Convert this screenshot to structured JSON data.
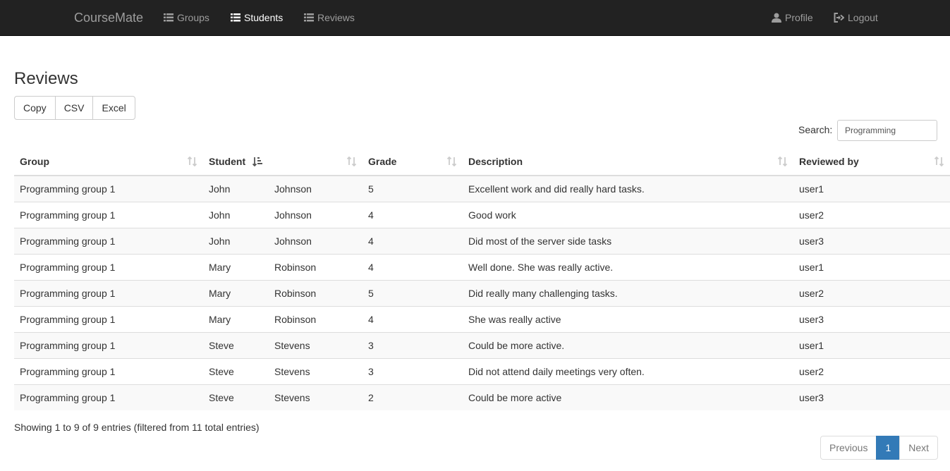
{
  "navbar": {
    "brand": "CourseMate",
    "links": [
      {
        "label": "Groups",
        "icon": "list-icon"
      },
      {
        "label": "Students",
        "icon": "list-icon"
      },
      {
        "label": "Reviews",
        "icon": "list-icon"
      }
    ],
    "profile": {
      "label": "Profile",
      "icon": "user-icon"
    },
    "logout": {
      "label": "Logout",
      "icon": "logout-icon"
    },
    "active_link": "Students"
  },
  "page": {
    "title": "Reviews"
  },
  "export": {
    "copy": "Copy",
    "csv": "CSV",
    "excel": "Excel"
  },
  "search": {
    "label": "Search:",
    "value": "Programming"
  },
  "table": {
    "headers": {
      "group": "Group",
      "student": "Student",
      "grade": "Grade",
      "description": "Description",
      "reviewed_by": "Reviewed by"
    },
    "rows": [
      [
        "Programming group 1",
        "John",
        "Johnson",
        "5",
        "Excellent work and did really hard tasks.",
        "user1"
      ],
      [
        "Programming group 1",
        "John",
        "Johnson",
        "4",
        "Good work",
        "user2"
      ],
      [
        "Programming group 1",
        "John",
        "Johnson",
        "4",
        "Did most of the server side tasks",
        "user3"
      ],
      [
        "Programming group 1",
        "Mary",
        "Robinson",
        "4",
        "Well done. She was really active.",
        "user1"
      ],
      [
        "Programming group 1",
        "Mary",
        "Robinson",
        "5",
        "Did really many challenging tasks.",
        "user2"
      ],
      [
        "Programming group 1",
        "Mary",
        "Robinson",
        "4",
        "She was really active",
        "user3"
      ],
      [
        "Programming group 1",
        "Steve",
        "Stevens",
        "3",
        "Could be more active.",
        "user1"
      ],
      [
        "Programming group 1",
        "Steve",
        "Stevens",
        "3",
        "Did not attend daily meetings very often.",
        "user2"
      ],
      [
        "Programming group 1",
        "Steve",
        "Stevens",
        "2",
        "Could be more active",
        "user3"
      ]
    ]
  },
  "footer": {
    "info": "Showing 1 to 9 of 9 entries (filtered from 11 total entries)",
    "previous": "Previous",
    "page": "1",
    "next": "Next"
  },
  "colors": {
    "navbar_bg": "#222222",
    "active_page": "#337ab7",
    "nav_text": "#9d9d9d"
  }
}
